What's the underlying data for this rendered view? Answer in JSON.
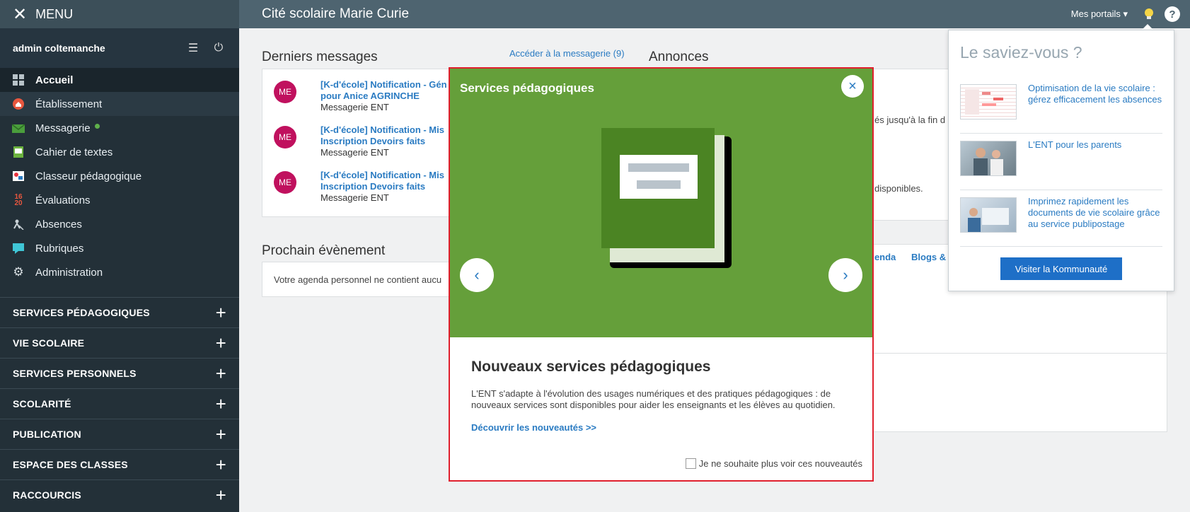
{
  "sidebar": {
    "menu_label": "MENU",
    "user": "admin coltemanche",
    "items": [
      {
        "label": "Accueil"
      },
      {
        "label": "Établissement"
      },
      {
        "label": "Messagerie"
      },
      {
        "label": "Cahier de textes"
      },
      {
        "label": "Classeur pédagogique"
      },
      {
        "label": "Évaluations"
      },
      {
        "label": "Absences"
      },
      {
        "label": "Rubriques"
      },
      {
        "label": "Administration"
      }
    ],
    "sections": [
      {
        "label": "SERVICES PÉDAGOGIQUES"
      },
      {
        "label": "VIE SCOLAIRE"
      },
      {
        "label": "SERVICES PERSONNELS"
      },
      {
        "label": "SCOLARITÉ"
      },
      {
        "label": "PUBLICATION"
      },
      {
        "label": "ESPACE DES CLASSES"
      },
      {
        "label": "RACCOURCIS"
      }
    ],
    "messagerie_dot_color": "#5fb04b"
  },
  "topbar": {
    "title": "Cité scolaire Marie Curie",
    "portails": "Mes portails",
    "help": "?"
  },
  "messages": {
    "title": "Derniers messages",
    "link": "Accéder à la messagerie (9)",
    "items": [
      {
        "avatar": "ME",
        "line1": "[K-d'école] Notification - Gén",
        "line2": "pour Anice AGRINCHE",
        "sender": "Messagerie ENT"
      },
      {
        "avatar": "ME",
        "line1": "[K-d'école] Notification - Mis",
        "line2": "Inscription Devoirs faits",
        "sender": "Messagerie ENT"
      },
      {
        "avatar": "ME",
        "line1": "[K-d'école] Notification - Mis",
        "line2": "Inscription Devoirs faits",
        "sender": "Messagerie ENT"
      }
    ]
  },
  "annonces": {
    "title": "Annonces",
    "snippet1": "és jusqu'à la fin d",
    "snippet2": "disponibles."
  },
  "events": {
    "title": "Prochain évènement",
    "empty": "Votre agenda personnel ne contient aucu",
    "tab1": "genda",
    "tab2": "Blogs &"
  },
  "modal": {
    "title": "Services pédagogiques",
    "close": "×",
    "prev": "‹",
    "next": "›",
    "heading": "Nouveaux services pédagogiques",
    "body": "L'ENT s'adapte à l'évolution des usages numériques et des pratiques pédagogiques : de nouveaux services sont disponibles pour aider les enseignants et les élèves au quotidien.",
    "link": "Découvrir les nouveautés >>",
    "checkbox": "Je ne souhaite plus voir ces nouveautés",
    "bg_color": "#659f3a"
  },
  "popover": {
    "title": "Le saviez-vous ?",
    "items": [
      {
        "text": "Optimisation de la vie scolaire : gérez efficacement les absences"
      },
      {
        "text": "L'ENT pour les parents"
      },
      {
        "text": "Imprimez rapidement les documents de vie scolaire grâce au service publipostage"
      }
    ],
    "button": "Visiter la Kommunauté"
  }
}
